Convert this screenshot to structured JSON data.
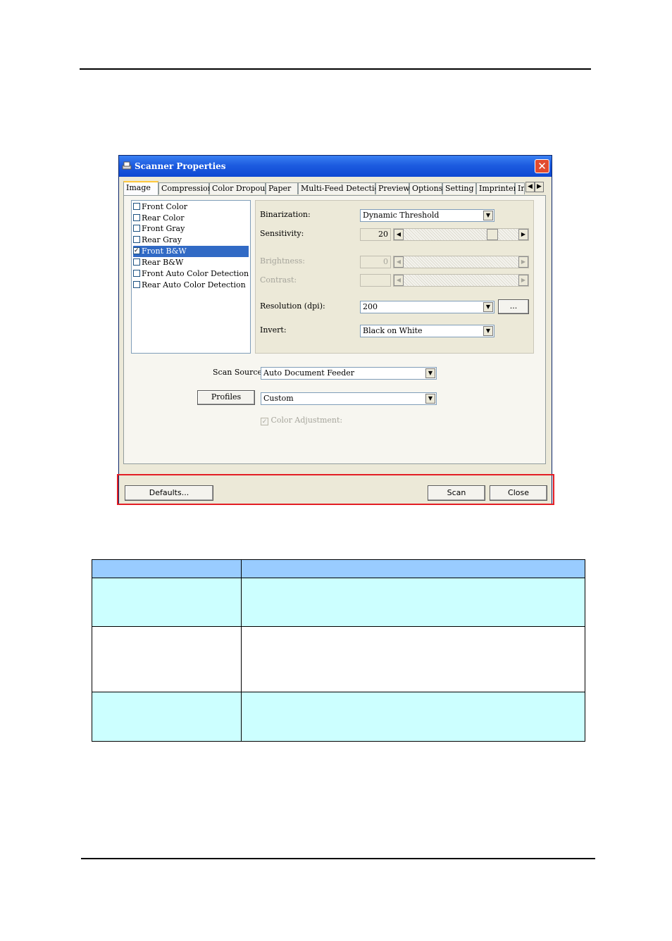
{
  "dialog": {
    "title": "Scanner Properties",
    "close_glyph": "✕",
    "tabs": [
      "Image",
      "Compression",
      "Color Dropout",
      "Paper",
      "Multi-Feed Detection",
      "Preview",
      "Options",
      "Setting",
      "Imprinter",
      "Ir"
    ],
    "active_tab": "Image",
    "image_types": [
      {
        "label": "Front Color",
        "checked": false
      },
      {
        "label": "Rear Color",
        "checked": false
      },
      {
        "label": "Front Gray",
        "checked": false
      },
      {
        "label": "Rear Gray",
        "checked": false
      },
      {
        "label": "Front B&W",
        "checked": true,
        "selected": true
      },
      {
        "label": "Rear B&W",
        "checked": false
      },
      {
        "label": "Front Auto Color Detection",
        "checked": false
      },
      {
        "label": "Rear Auto Color Detection",
        "checked": false
      }
    ],
    "binarization": {
      "label": "Binarization:",
      "value": "Dynamic Threshold"
    },
    "sensitivity": {
      "label": "Sensitivity:",
      "value": "20",
      "level": 0.8
    },
    "brightness": {
      "label": "Brightness:",
      "value": "0"
    },
    "contrast": {
      "label": "Contrast:",
      "value": ""
    },
    "resolution": {
      "label": "Resolution (dpi):",
      "value": "200",
      "more_label": "..."
    },
    "invert": {
      "label": "Invert:",
      "value": "Black on White"
    },
    "scan_source": {
      "label": "Scan Source:",
      "value": "Auto Document Feeder"
    },
    "profiles": {
      "button_label": "Profiles",
      "value": "Custom"
    },
    "color_adjustment": {
      "label": "Color Adjustment:",
      "checked": true
    },
    "buttons": {
      "defaults": "Defaults...",
      "scan": "Scan",
      "close": "Close"
    }
  },
  "colors": {
    "titlebar": "#0d47d2",
    "highlight_box": "#e31e24",
    "table_header": "#99ccff",
    "table_row_tint": "#ccffff"
  },
  "icons": {
    "scanner": "scanner-icon",
    "close": "close-icon",
    "dropdown": "dropdown-arrow-icon",
    "scroll_left": "arrow-left-icon",
    "scroll_right": "arrow-right-icon",
    "check": "checkmark-icon"
  },
  "glyphs": {
    "down": "▼",
    "left": "◀",
    "right": "▶"
  }
}
